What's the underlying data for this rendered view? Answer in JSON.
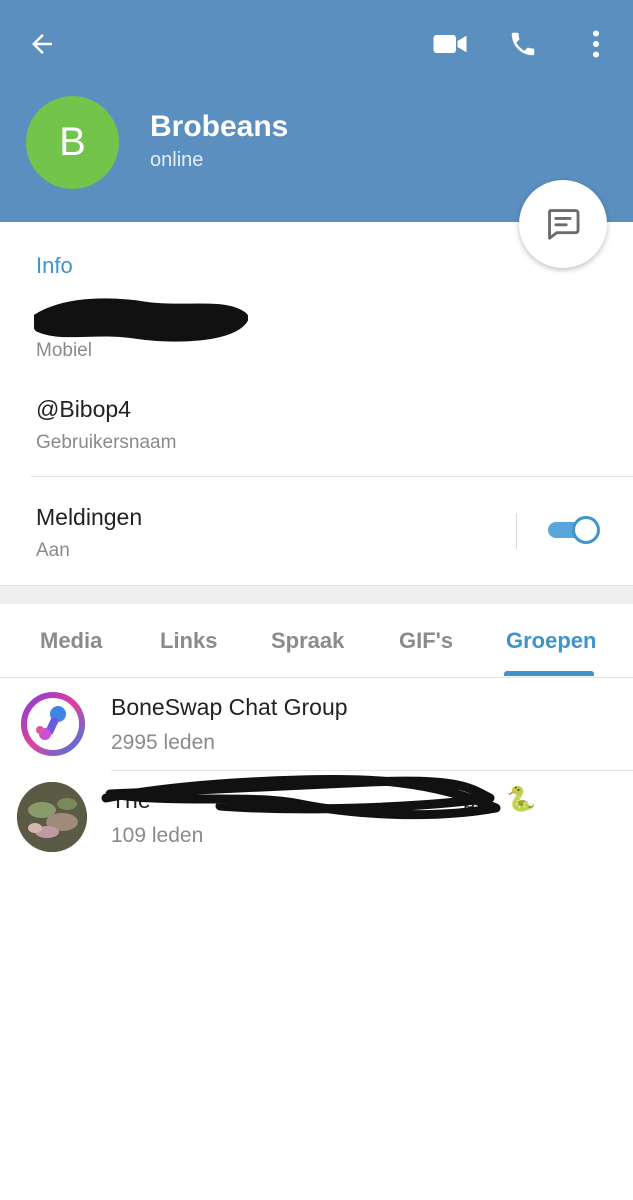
{
  "header": {
    "avatar_letter": "B",
    "name": "Brobeans",
    "status": "online",
    "colors": {
      "bar": "#5b8fbf",
      "avatar": "#72c44b"
    },
    "icons": [
      "back-arrow-icon",
      "video-call-icon",
      "phone-icon",
      "more-vert-icon",
      "message-icon"
    ]
  },
  "info": {
    "section_title": "Info",
    "phone_label": "Mobiel",
    "username": "@Bibop4",
    "username_label": "Gebruikersnaam",
    "notifications": "Meldingen",
    "notifications_state": "Aan",
    "notifications_on": true
  },
  "tabs": [
    {
      "label": "Media",
      "active": false
    },
    {
      "label": "Links",
      "active": false
    },
    {
      "label": "Spraak",
      "active": false
    },
    {
      "label": "GIF's",
      "active": false
    },
    {
      "label": "Groepen",
      "active": true
    }
  ],
  "groups": [
    {
      "name": "BoneSwap Chat Group",
      "members": "2995 leden"
    },
    {
      "name": "The",
      "name_end": "pe.",
      "name_redacted": true,
      "emoji": "🐍",
      "members": "109 leden"
    }
  ],
  "accent": "#3d95c9"
}
